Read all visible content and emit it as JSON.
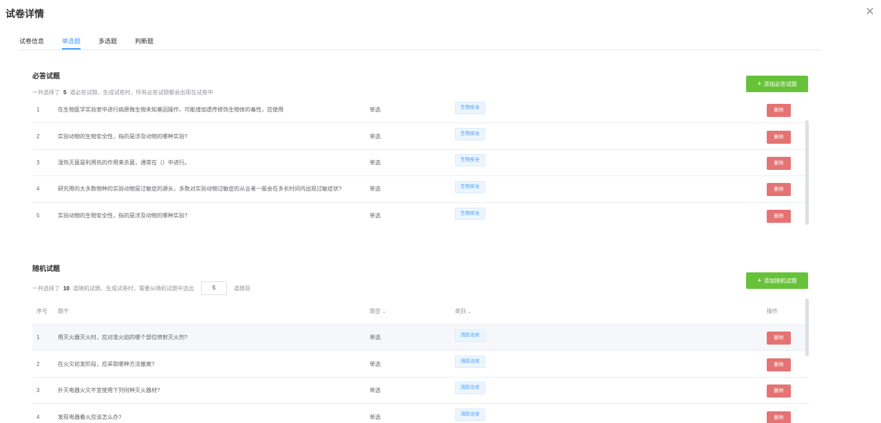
{
  "dialog": {
    "title": "试卷详情"
  },
  "tabs": [
    {
      "label": "试卷信息"
    },
    {
      "label": "单选题"
    },
    {
      "label": "多选题"
    },
    {
      "label": "判断题"
    }
  ],
  "required": {
    "title": "必答试题",
    "desc_prefix": "一共选择了",
    "count": "5",
    "desc_suffix": "道必答试题，生成试卷时，所有必答试题都会出现在试卷中",
    "add_label": "添加必答试题",
    "rows": [
      {
        "idx": "1",
        "stem": "在生物医学实验室中进行病原微生物未知基因操作，可能增加遗传修饰生物体的毒性，应使用",
        "type": "单选",
        "category": "生物安全",
        "op": "删除"
      },
      {
        "idx": "2",
        "stem": "实验动物的生物安全性，指的是涉及动物的哪种实验?",
        "type": "单选",
        "category": "生物安全",
        "op": "删除"
      },
      {
        "idx": "3",
        "stem": "湿热灭菌是利用热的作用来杀菌，通常在（）中进行。",
        "type": "单选",
        "category": "生物安全",
        "op": "删除"
      },
      {
        "idx": "4",
        "stem": "研究用的大多数物种的实验动物是过敏症的源头，多数对实验动物过敏症的从业者一般会在多长时间内出现过敏症状?",
        "type": "单选",
        "category": "生物安全",
        "op": "删除"
      },
      {
        "idx": "5",
        "stem": "实验动物的生物安全性，指的是涉及动物的哪种实验?",
        "type": "单选",
        "category": "生物安全",
        "op": "删除"
      }
    ]
  },
  "random": {
    "title": "随机试题",
    "desc_prefix": "一共选择了",
    "count": "10",
    "desc_mid": "道随机试题，生成试卷时，需要从随机试题中选出",
    "pick_count": "5",
    "desc_suffix": "道题目",
    "add_label": "添加随机试题",
    "columns": {
      "idx": "序号",
      "stem": "题干",
      "type": "题型",
      "category": "类别",
      "op": "操作"
    },
    "rows": [
      {
        "idx": "1",
        "stem": "用灭火器灭火时，应对准火焰的哪个部位喷射灭火剂?",
        "type": "单选",
        "category": "消防治安",
        "op": "删除"
      },
      {
        "idx": "2",
        "stem": "在火灾初发阶段，应采取哪种方法撤离?",
        "type": "单选",
        "category": "消防治安",
        "op": "删除"
      },
      {
        "idx": "3",
        "stem": "扑灭电器火灾不宜使用下列何种灭火器材?",
        "type": "单选",
        "category": "消防治安",
        "op": "删除"
      },
      {
        "idx": "4",
        "stem": "发现电器着火应该怎么办?",
        "type": "单选",
        "category": "消防治安",
        "op": "删除"
      }
    ]
  },
  "icons": {
    "close": "close-icon",
    "plus": "plus-icon",
    "sort": "caret-down-icon"
  }
}
